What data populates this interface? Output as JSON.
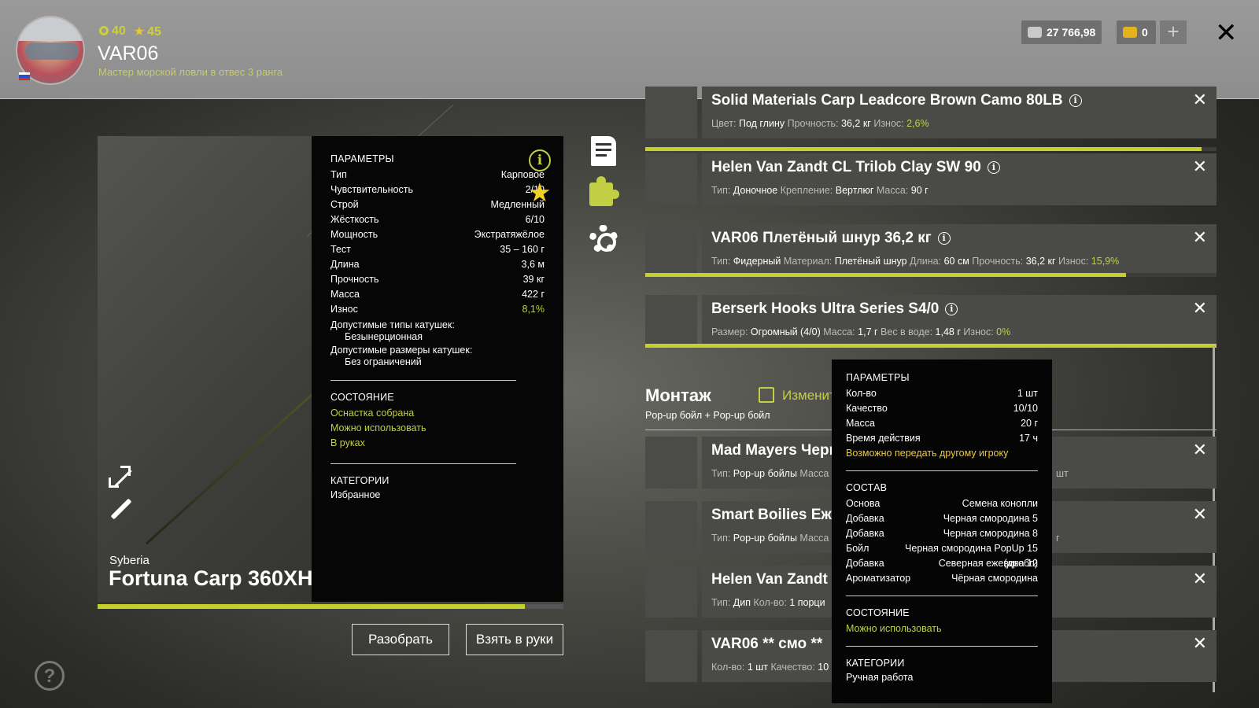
{
  "header": {
    "level": "40",
    "stars": "45",
    "nickname": "VAR06",
    "rank": "Мастер морской ловли в отвес 3 ранга",
    "silver": "27 766,98",
    "gold": "0",
    "plus": "+",
    "close": "✕"
  },
  "rod": {
    "brand": "Syberia",
    "name": "Fortuna Carp 360XH",
    "condition_fraction": 0.918,
    "buttons": {
      "disassemble": "Разобрать",
      "take": "Взять в руки"
    }
  },
  "params": {
    "title": "ПАРАМЕТРЫ",
    "info": "i",
    "rows": [
      {
        "k": "Тип",
        "v": "Карповое"
      },
      {
        "k": "Чувствительность",
        "v": "2/10"
      },
      {
        "k": "Строй",
        "v": "Медленный"
      },
      {
        "k": "Жёсткость",
        "v": "6/10"
      },
      {
        "k": "Мощность",
        "v": "Экстратяжёлое"
      },
      {
        "k": "Тест",
        "v": "35 – 160 г"
      },
      {
        "k": "Длина",
        "v": "3,6 м"
      },
      {
        "k": "Прочность",
        "v": "39 кг"
      },
      {
        "k": "Масса",
        "v": "422 г"
      },
      {
        "k": "Износ",
        "v": "8,1%"
      }
    ],
    "reel_types_label": "Допустимые типы катушек:",
    "reel_types_value": "Безынерционная",
    "reel_sizes_label": "Допустимые размеры катушек:",
    "reel_sizes_value": "Без ограничений",
    "state_title": "СОСТОЯНИЕ",
    "state": [
      "Оснастка собрана",
      "Можно использовать",
      "В руках"
    ],
    "cat_title": "КАТЕГОРИИ",
    "category": "Избранное"
  },
  "items": [
    {
      "title": "Solid Materials Carp Leadcore Brown Camo 80LB",
      "meta": [
        [
          "Цвет: ",
          "Под глину"
        ],
        [
          " Прочность: ",
          "36,2 кг"
        ],
        [
          " Износ: ",
          ""
        ]
      ],
      "wear_text": "2,6%",
      "wear": 0.974
    },
    {
      "title": "Helen Van Zandt CL Trilob Clay SW 90",
      "meta": [
        [
          "Тип: ",
          "Доночное"
        ],
        [
          " Крепление: ",
          "Вертлюг"
        ],
        [
          " Масса: ",
          "90 г"
        ]
      ],
      "wear_text": "",
      "wear": null
    },
    {
      "title": "VAR06 Плетёный шнур 36,2 кг",
      "meta": [
        [
          "Тип: ",
          "Фидерный"
        ],
        [
          " Материал: ",
          "Плетёный шнур"
        ],
        [
          " Длина: ",
          "60 см"
        ],
        [
          " Прочность: ",
          "36,2 кг"
        ],
        [
          " Износ: ",
          ""
        ]
      ],
      "wear_text": "15,9%",
      "wear": 0.841
    },
    {
      "title": "Berserk Hooks Ultra Series S4/0",
      "meta": [
        [
          "Размер: ",
          "Огромный (4/0)"
        ],
        [
          " Масса: ",
          "1,7 г"
        ],
        [
          " Вес в воде: ",
          "1,48 г"
        ],
        [
          " Износ: ",
          ""
        ]
      ],
      "wear_text": "0%",
      "wear": 1.0
    }
  ],
  "montage": {
    "title": "Монтаж",
    "subtitle": "Pop-up бойл  +  Pop-up бойл",
    "edit": "Изменит"
  },
  "baits": [
    {
      "title": "Mad Mayers Черн",
      "meta_k": "Тип: ",
      "meta_v": "Pop-up бойлы",
      "meta_k2": " Масса",
      "tail": "шт"
    },
    {
      "title": "Smart Boilies Ежев",
      "meta_k": "Тип: ",
      "meta_v": "Pop-up бойлы",
      "meta_k2": " Масса",
      "tail": "г"
    },
    {
      "title": "Helen Van Zandt Ч",
      "meta_k": "Тип: ",
      "meta_v": "Дип",
      "meta_k2": " Кол-во: ",
      "meta_v2": "1 порци",
      "tail": ""
    },
    {
      "title": "VAR06 ** смо **",
      "meta_k": "Кол-во: ",
      "meta_v": "1 шт",
      "meta_k2": " Качество: ",
      "meta_v2": "10",
      "tail": ""
    }
  ],
  "tooltip": {
    "title": "ПАРАМЕТРЫ",
    "rows": [
      {
        "k": "Кол-во",
        "v": "1 шт"
      },
      {
        "k": "Качество",
        "v": "10/10"
      },
      {
        "k": "Масса",
        "v": "20 г"
      },
      {
        "k": "Время действия",
        "v": "17 ч"
      }
    ],
    "transfer": "Возможно передать другому игроку",
    "comp_title": "СОСТАВ",
    "comp": [
      {
        "k": "Основа",
        "v": "Семена конопли"
      },
      {
        "k": "Добавка",
        "v": "Черная смородина 5"
      },
      {
        "k": "Добавка",
        "v": "Черная смородина 8"
      },
      {
        "k": "Бойл",
        "v": "Черная смородина PopUp 15 (дробл)"
      },
      {
        "k": "Добавка",
        "v": "Северная ежевика 12"
      },
      {
        "k": "Ароматизатор",
        "v": "Чёрная смородина"
      }
    ],
    "state_title": "СОСТОЯНИЕ",
    "state": "Можно использовать",
    "cat_title": "КАТЕГОРИИ",
    "category": "Ручная работа"
  },
  "colors": {
    "accent": "#c4d12c",
    "yellow": "#f0c93a"
  }
}
